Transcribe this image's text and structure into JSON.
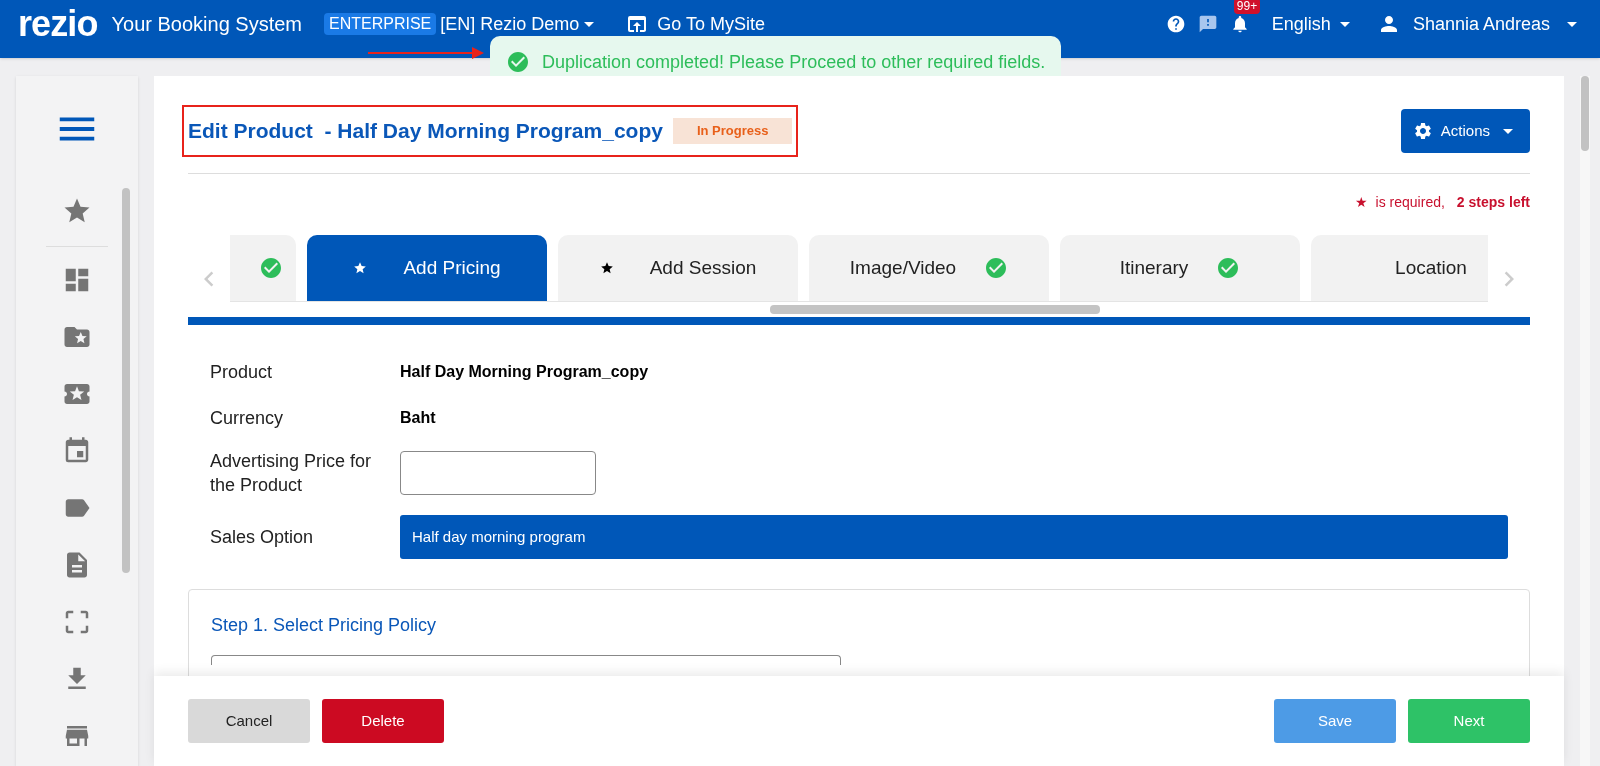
{
  "header": {
    "logo": "rezio",
    "app_title": "Your Booking System",
    "plan_badge": "ENTERPRISE",
    "account": "[EN] Rezio Demo",
    "mysite_link": "Go To MySite",
    "notification_count": "99+",
    "language": "English",
    "user": "Shannia Andreas"
  },
  "toast": {
    "message": "Duplication completed! Please Proceed to other required fields."
  },
  "page": {
    "title": "Edit Product  - Half Day Morning Program_copy",
    "status": "In Progress",
    "actions_button": "Actions",
    "required_star": "★",
    "required_note": "is required,",
    "steps_left": "2 steps left"
  },
  "tabs": [
    {
      "required": false,
      "completed": true,
      "selected": false
    },
    {
      "label": "Add Pricing",
      "required": true,
      "completed": false,
      "selected": true
    },
    {
      "label": "Add Session",
      "required": true,
      "completed": false,
      "selected": false
    },
    {
      "label": "Image/Video",
      "required": false,
      "completed": true,
      "selected": false
    },
    {
      "label": "Itinerary",
      "required": false,
      "completed": true,
      "selected": false
    },
    {
      "label": "Location",
      "required": false,
      "completed": false,
      "selected": false
    }
  ],
  "form": [
    {
      "kind": "text",
      "label": "Product",
      "value": "Half Day Morning Program_copy"
    },
    {
      "kind": "text",
      "label": "Currency",
      "value": "Baht"
    },
    {
      "kind": "input",
      "label": "Advertising Price for the Product"
    },
    {
      "kind": "select",
      "label": "Sales Option",
      "value": "Half day morning program"
    }
  ],
  "step_card": {
    "title": "Step 1. Select Pricing Policy"
  },
  "footer": {
    "cancel": "Cancel",
    "delete": "Delete",
    "save": "Save",
    "next": "Next"
  }
}
